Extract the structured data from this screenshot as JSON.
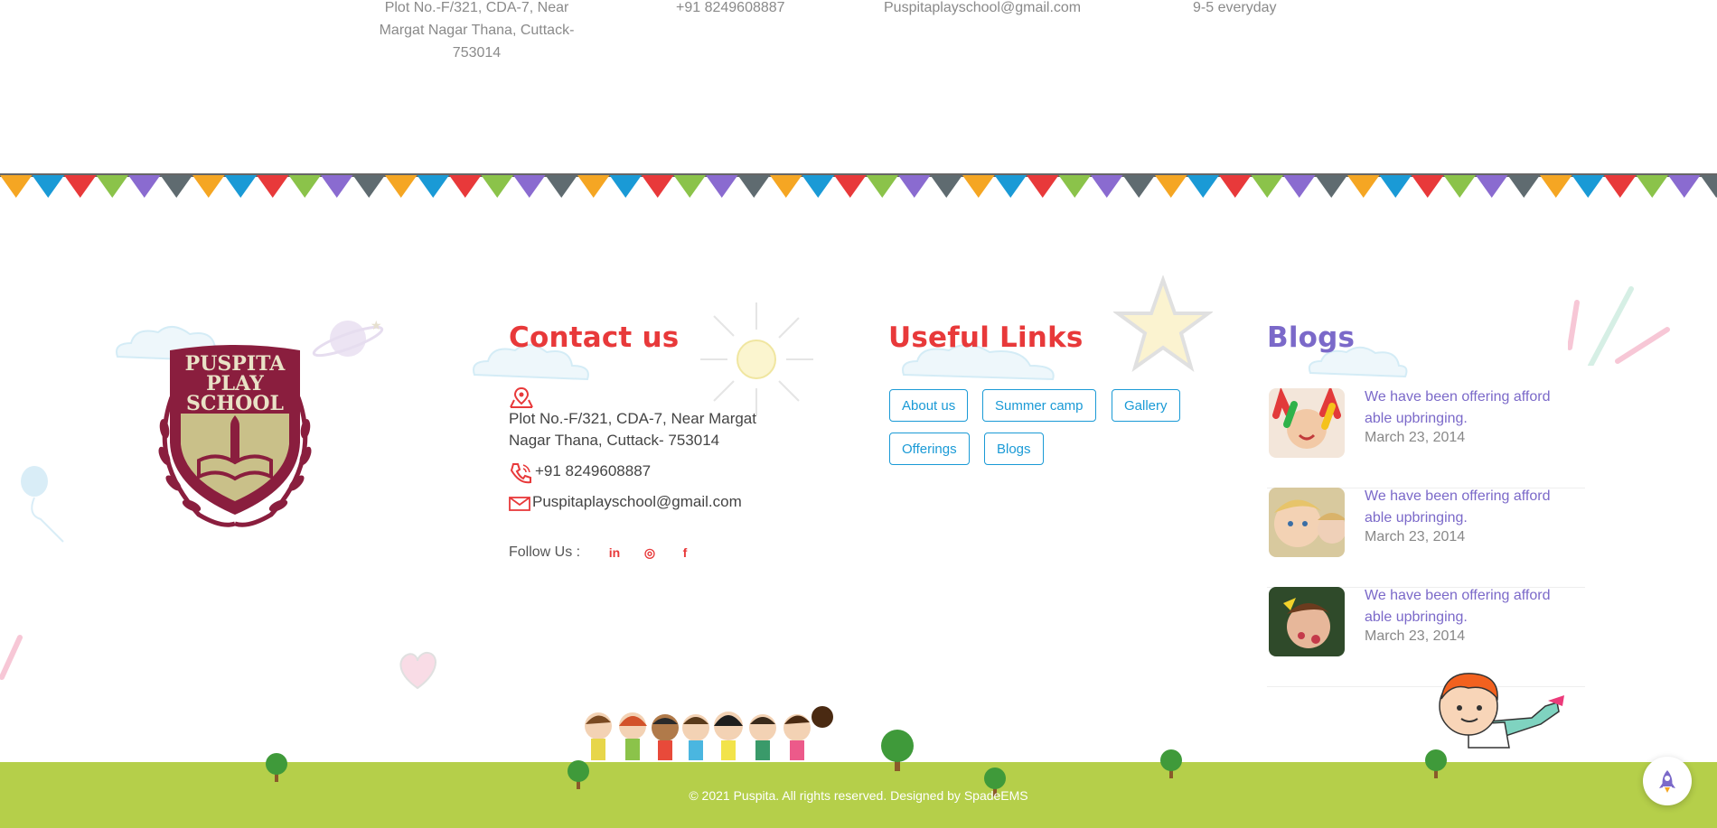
{
  "top_info": {
    "address": "Plot No.-F/321, CDA-7, Near Margat Nagar Thana, Cuttack- 753014",
    "phone": "+91 8249608887",
    "email": "Puspitaplayschool@gmail.com",
    "hours": "9-5 everyday"
  },
  "logo": {
    "line1": "PUSPITA",
    "line2": "PLAY",
    "line3": "SCHOOL"
  },
  "contact": {
    "heading": "Contact us",
    "address": "Plot No.-F/321, CDA-7, Near Margat Nagar Thana, Cuttack- 753014",
    "phone": "+91 8249608887",
    "email": "Puspitaplayschool@gmail.com",
    "follow_label": "Follow Us :",
    "social": [
      {
        "name": "linkedin-icon",
        "glyph": "in"
      },
      {
        "name": "instagram-icon",
        "glyph": "◎"
      },
      {
        "name": "facebook-icon",
        "glyph": "f"
      }
    ]
  },
  "useful_links": {
    "heading": "Useful Links",
    "items": [
      "About us",
      "Summer camp",
      "Gallery",
      "Offerings",
      "Blogs"
    ]
  },
  "blogs": {
    "heading": "Blogs",
    "items": [
      {
        "title": "We have been offering afford able upbringing.",
        "date": "March 23, 2014"
      },
      {
        "title": "We have been offering afford able upbringing.",
        "date": "March 23, 2014"
      },
      {
        "title": "We have been offering afford able upbringing.",
        "date": "March 23, 2014"
      }
    ]
  },
  "footer": {
    "copyright": "© 2021 Puspita. All rights reserved. Designed by SpadeEMS"
  },
  "colors": {
    "accent_red": "#e8393a",
    "accent_purple": "#7b69c9",
    "link_blue": "#1a9ad6",
    "grass": "#b5cf4a",
    "logo_maroon": "#8a1e3e"
  }
}
